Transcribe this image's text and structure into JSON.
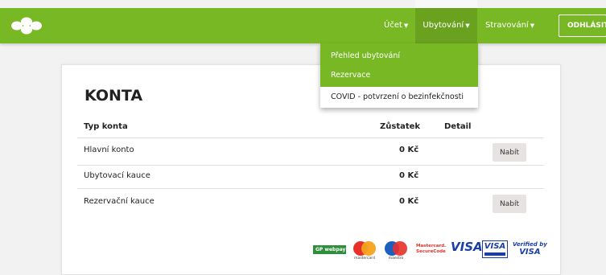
{
  "nav": {
    "account": "Účet",
    "accommodation": "Ubytování",
    "dining": "Stravování",
    "logout": "ODHLÁSIT"
  },
  "dropdown": {
    "items": [
      "Přehled ubytování",
      "Rezervace",
      "COVID - potvrzení o bezinfekčnosti"
    ]
  },
  "page": {
    "title": "KONTA",
    "columns": {
      "type": "Typ konta",
      "balance": "Zůstatek",
      "detail": "Detail"
    },
    "rows": [
      {
        "name": "Hlavní konto",
        "balance": "0 Kč",
        "action": "Nabít"
      },
      {
        "name": "Ubytovací kauce",
        "balance": "0 Kč",
        "action": ""
      },
      {
        "name": "Rezervační kauce",
        "balance": "0 Kč",
        "action": "Nabít"
      }
    ]
  },
  "payments": {
    "gp": "GP webpay",
    "mastercard": "mastercard",
    "maestro": "maestro",
    "securecode_1": "Mastercard.",
    "securecode_2": "SecureCode",
    "visa": "VISA",
    "visa_electron": "VISA",
    "verified_1": "Verified by",
    "verified_2": "VISA"
  },
  "colors": {
    "brand_green": "#78b825",
    "brand_green_dark": "#6aa11f",
    "card_bg": "#ffffff"
  }
}
